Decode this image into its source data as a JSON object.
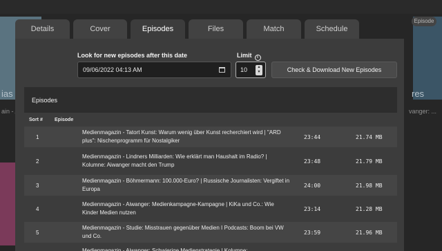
{
  "background": {
    "left_caption": "ain - A",
    "right_caption": "vanger: ...",
    "left_overlay_text": "ias",
    "right_overlay_text": "res",
    "badge": "Episode"
  },
  "tabs": [
    {
      "label": "Details"
    },
    {
      "label": "Cover"
    },
    {
      "label": "Episodes",
      "active": true
    },
    {
      "label": "Files"
    },
    {
      "label": "Match"
    },
    {
      "label": "Schedule"
    }
  ],
  "form": {
    "date_label": "Look for new episodes after this date",
    "date_value": "09/06/2022 04:13 AM",
    "limit_label": "Limit",
    "limit_value": "10",
    "check_button": "Check & Download New Episodes"
  },
  "episodes": {
    "title": "Episodes",
    "columns": {
      "sort": "Sort #",
      "episode": "Episode"
    },
    "rows": [
      {
        "num": "1",
        "title": "Medienmagazin - Tatort Kunst: Warum wenig über Kunst recherchiert wird | \"ARD plus\": Nischenprogramm für Nostalgiker",
        "duration": "23:44",
        "size": "21.74 MB"
      },
      {
        "num": "2",
        "title": "Medienmagazin - Lindners Milliarden: Wie erklärt man Haushalt im Radio? | Kolumne: Aiwanger macht den Trump",
        "duration": "23:48",
        "size": "21.79 MB"
      },
      {
        "num": "3",
        "title": "Medienmagazin - Böhmermann: 100.000-Euro? | Russische Journalisten: Vergiftet in Europa",
        "duration": "24:00",
        "size": "21.98 MB"
      },
      {
        "num": "4",
        "title": "Medienmagazin - Aiwanger: Medienkampagne-Kampagne | KiKa und Co.: Wie Kinder Medien nutzen",
        "duration": "23:14",
        "size": "21.28 MB"
      },
      {
        "num": "5",
        "title": "Medienmagazin - Studie: Misstrauen gegenüber Medien I Podcasts: Boom bei VW und Co.",
        "duration": "23:59",
        "size": "21.96 MB"
      },
      {
        "num": "6",
        "title": "Medienmagazin - Aiwanger: Schwierige Medienstrategie | Kolumne:",
        "duration": "",
        "size": ""
      }
    ]
  }
}
